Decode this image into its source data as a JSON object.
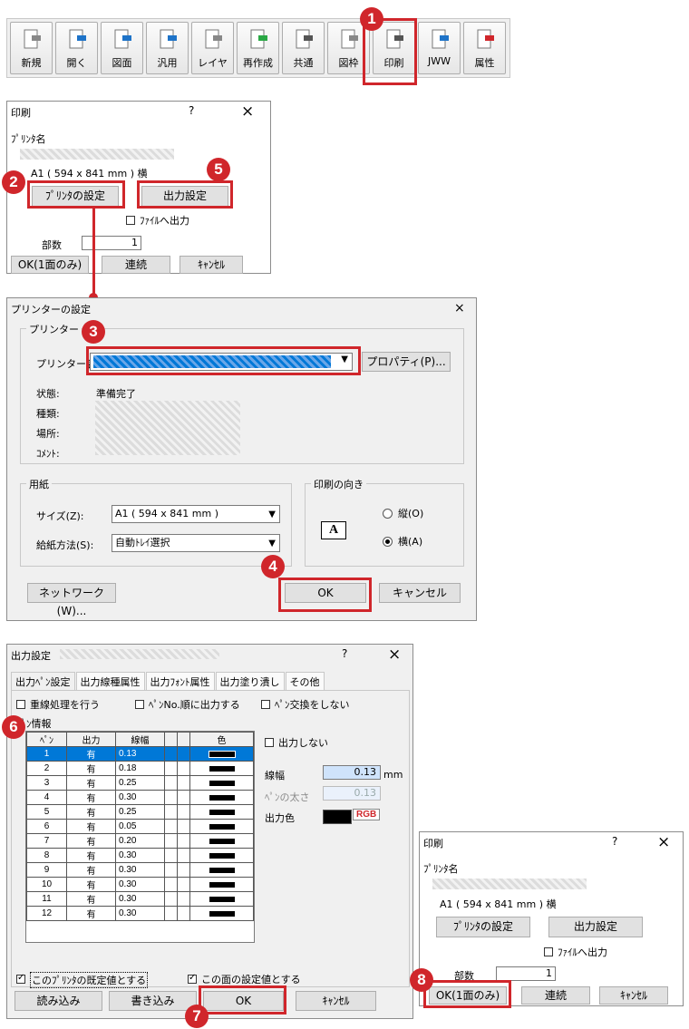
{
  "toolbar": {
    "buttons": [
      "新規",
      "開く",
      "図面",
      "汎用",
      "レイヤ",
      "再作成",
      "共通",
      "図枠",
      "印刷",
      "JWW",
      "属性"
    ]
  },
  "print_dialog": {
    "title": "印刷",
    "help": "?",
    "close": "×",
    "printer_label": "ﾌﾟﾘﾝﾀ名",
    "paper": "A1 ( 594 x 841 mm ) 横",
    "printer_settings_btn": "ﾌﾟﾘﾝﾀの設定",
    "output_settings_btn": "出力設定",
    "file_output_label": "ﾌｧｲﾙへ出力",
    "copies_label": "部数",
    "copies_value": "1",
    "ok_btn": "OK(1面のみ)",
    "continuous_btn": "連続",
    "cancel_btn": "ｷｬﾝｾﾙ"
  },
  "printer_setup": {
    "title": "プリンターの設定",
    "close": "×",
    "group_printer": "プリンター",
    "printer_name_label": "プリンター名(N):",
    "properties_btn": "プロパティ(P)...",
    "status_label": "状態:",
    "status_value": "準備完了",
    "type_label": "種類:",
    "location_label": "場所:",
    "comment_label": "ｺﾒﾝﾄ:",
    "group_paper": "用紙",
    "size_label": "サイズ(Z):",
    "size_value": "A1 ( 594 x 841 mm )",
    "source_label": "給紙方法(S):",
    "source_value": "自動ﾄﾚｲ選択",
    "group_orientation": "印刷の向き",
    "portrait_label": "縦(O)",
    "landscape_label": "横(A)",
    "network_btn": "ネットワーク(W)...",
    "ok_btn": "OK",
    "cancel_btn": "キャンセル"
  },
  "output_settings": {
    "title": "出力設定",
    "help": "?",
    "close": "×",
    "tabs": [
      "出力ﾍﾟﾝ設定",
      "出力線種属性",
      "出力ﾌｫﾝﾄ属性",
      "出力塗り潰し",
      "その他"
    ],
    "check_overlap": "重線処理を行う",
    "check_pen_order": "ﾍﾟﾝNo.順に出力する",
    "check_no_pen_swap": "ﾍﾟﾝ交換をしない",
    "pen_info_label": "ﾍﾟﾝ情報",
    "columns": [
      "ﾍﾟﾝ",
      "出力",
      "線幅",
      "",
      "",
      "色"
    ],
    "rows": [
      [
        "1",
        "有",
        "0.13"
      ],
      [
        "2",
        "有",
        "0.18"
      ],
      [
        "3",
        "有",
        "0.25"
      ],
      [
        "4",
        "有",
        "0.30"
      ],
      [
        "5",
        "有",
        "0.25"
      ],
      [
        "6",
        "有",
        "0.05"
      ],
      [
        "7",
        "有",
        "0.20"
      ],
      [
        "8",
        "有",
        "0.30"
      ],
      [
        "9",
        "有",
        "0.30"
      ],
      [
        "10",
        "有",
        "0.30"
      ],
      [
        "11",
        "有",
        "0.30"
      ],
      [
        "12",
        "有",
        "0.30"
      ]
    ],
    "no_output_label": "出力しない",
    "line_width_label": "線幅",
    "line_width_value": "0.13",
    "line_width_unit": "mm",
    "pen_thickness_label": "ﾍﾟﾝの太さ",
    "pen_thickness_value": "0.13",
    "output_color_label": "出力色",
    "rgb_label": "RGB",
    "default_check": "このﾌﾟﾘﾝﾀの既定値とする",
    "page_check": "この面の設定値とする",
    "read_btn": "読み込み",
    "write_btn": "書き込み",
    "ok_btn": "OK",
    "cancel_btn": "ｷｬﾝｾﾙ"
  },
  "print_dialog2": {
    "title": "印刷",
    "help": "?",
    "close": "×",
    "printer_label": "ﾌﾟﾘﾝﾀ名",
    "paper": "A1 ( 594 x 841 mm ) 横",
    "printer_settings_btn": "ﾌﾟﾘﾝﾀの設定",
    "output_settings_btn": "出力設定",
    "file_output_label": "ﾌｧｲﾙへ出力",
    "copies_label": "部数",
    "copies_value": "1",
    "ok_btn": "OK(1面のみ)",
    "continuous_btn": "連続",
    "cancel_btn": "ｷｬﾝｾﾙ"
  },
  "steps": [
    "1",
    "2",
    "3",
    "4",
    "5",
    "6",
    "7",
    "8"
  ],
  "colors": {
    "accent": "#d0262b",
    "selection": "#0078d7"
  }
}
